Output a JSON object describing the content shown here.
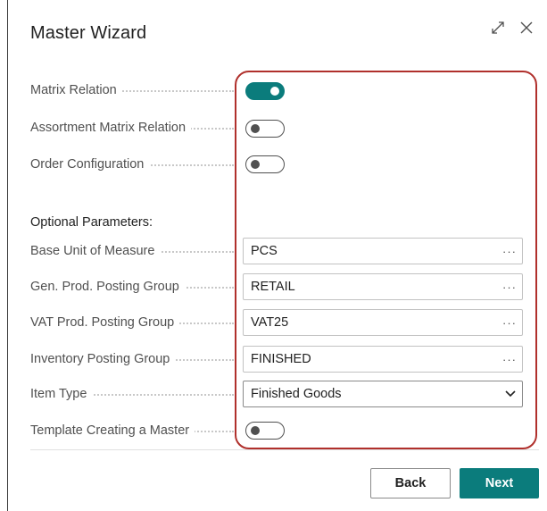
{
  "dialog": {
    "title": "Master Wizard",
    "icons": {
      "expand": "expand-icon",
      "close": "close-icon"
    }
  },
  "toggles": [
    {
      "label": "Matrix Relation",
      "on": true
    },
    {
      "label": "Assortment Matrix Relation",
      "on": false
    },
    {
      "label": "Order Configuration",
      "on": false
    }
  ],
  "optional": {
    "heading": "Optional Parameters:",
    "fields": [
      {
        "label": "Base Unit of Measure",
        "value": "PCS",
        "control": "lookup"
      },
      {
        "label": "Gen. Prod. Posting Group",
        "value": "RETAIL",
        "control": "lookup"
      },
      {
        "label": "VAT Prod. Posting Group",
        "value": "VAT25",
        "control": "lookup"
      },
      {
        "label": "Inventory Posting Group",
        "value": "FINISHED",
        "control": "lookup"
      },
      {
        "label": "Item Type",
        "value": "Finished Goods",
        "control": "dropdown"
      }
    ],
    "template_toggle": {
      "label": "Template Creating a Master",
      "on": false
    }
  },
  "footer": {
    "back_label": "Back",
    "next_label": "Next"
  },
  "colors": {
    "accent": "#0b7c7c",
    "highlight": "#b0302c",
    "label": "#505050"
  }
}
